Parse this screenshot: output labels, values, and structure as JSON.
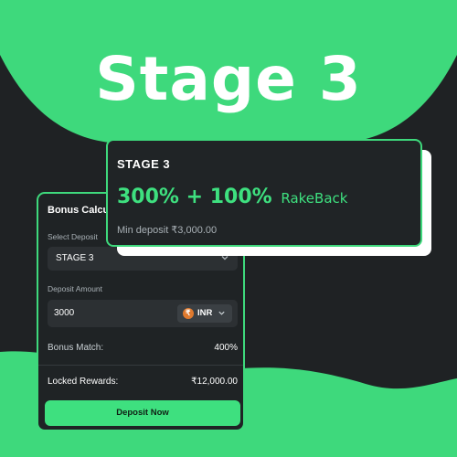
{
  "hero": {
    "title": "Stage 3"
  },
  "stage_card": {
    "label": "STAGE 3",
    "offer": "300% + 100%",
    "offer_suffix": "RakeBack",
    "min_deposit": "Min deposit ₹3,000.00"
  },
  "calculator": {
    "title": "Bonus Calcu",
    "select_label": "Select Deposit",
    "select_value": "STAGE 3",
    "amount_label": "Deposit Amount",
    "amount_value": "3000",
    "currency_symbol": "₹",
    "currency_code": "INR",
    "bonus_match_label": "Bonus Match:",
    "bonus_match_value": "400%",
    "locked_rewards_label": "Locked Rewards:",
    "locked_rewards_value": "₹12,000.00",
    "deposit_button": "Deposit Now"
  },
  "colors": {
    "accent_green": "#3ee07f",
    "background": "#1f2224",
    "panel": "#2c3033"
  }
}
